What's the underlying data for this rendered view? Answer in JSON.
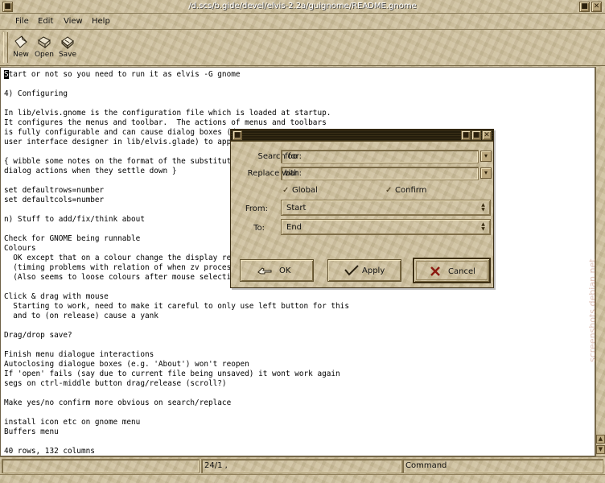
{
  "window": {
    "title": "/d.scs/b.gide/devel/elvis-2.2a/guignome/README.gnome",
    "buttons": [
      "■",
      "✕"
    ]
  },
  "menubar": {
    "items": [
      "File",
      "Edit",
      "View",
      "Help"
    ]
  },
  "toolbar": {
    "items": [
      {
        "label": "New",
        "icon": "new-file-icon"
      },
      {
        "label": "Open",
        "icon": "open-folder-icon"
      },
      {
        "label": "Save",
        "icon": "save-disk-icon"
      }
    ]
  },
  "editor": {
    "lines": [
      "Start or not so you need to run it as elvis -G gnome",
      "",
      "4) Configuring",
      "",
      "In lib/elvis.gnome is the configuration file which is loaded at startup.",
      "It configures the menus and toolbar.  The actions of menus and toolbars",
      "is fully configurable and can cause dialog boxes (d",
      "user interface designer in lib/elvis.glade) to appe",
      "",
      "{ wibble some notes on the format of the substituti",
      "dialog actions when they settle down }",
      "",
      "set defaultrows=number",
      "set defaultcols=number",
      "",
      "n) Stuff to add/fix/think about",
      "",
      "Check for GNOME being runnable",
      "Colours",
      "  OK except that on a colour change the display rec",
      "  (timing problems with relation of when zv process",
      "  (Also seems to loose colours after mouse selectio",
      "",
      "Click & drag with mouse",
      "  Starting to work, need to make it careful to only use left button for this",
      "  and to (on release) cause a yank",
      "",
      "Drag/drop save?",
      "",
      "Finish menu dialogue interactions",
      "Autoclosing dialogue boxes (e.g. 'About') won't reopen",
      "If 'open' fails (say due to current file being unsaved) it wont work again",
      "segs on ctrl-middle button drag/release (scroll?)",
      "",
      "Make yes/no confirm more obvious on search/replace",
      "",
      "install icon etc on gnome menu",
      "Buffers menu",
      "",
      "40 rows, 132 columns"
    ]
  },
  "statusbar": {
    "position": "24/1 ,",
    "mode": "Command"
  },
  "dialog": {
    "search_label": "Search for:",
    "search_value": "foo",
    "replace_label": "Replace with:",
    "replace_value": "bar",
    "global_label": "Global",
    "global_checked": true,
    "confirm_label": "Confirm",
    "confirm_checked": true,
    "from_label": "From:",
    "from_value": "Start",
    "to_label": "To:",
    "to_value": "End",
    "ok_label": "OK",
    "apply_label": "Apply",
    "cancel_label": "Cancel"
  },
  "watermark": "screenshots.debian.net",
  "colors": {
    "sand": "#cdbf9c",
    "editor_bg": "#ffffff",
    "dialog_titlebar": "#2b2310"
  }
}
